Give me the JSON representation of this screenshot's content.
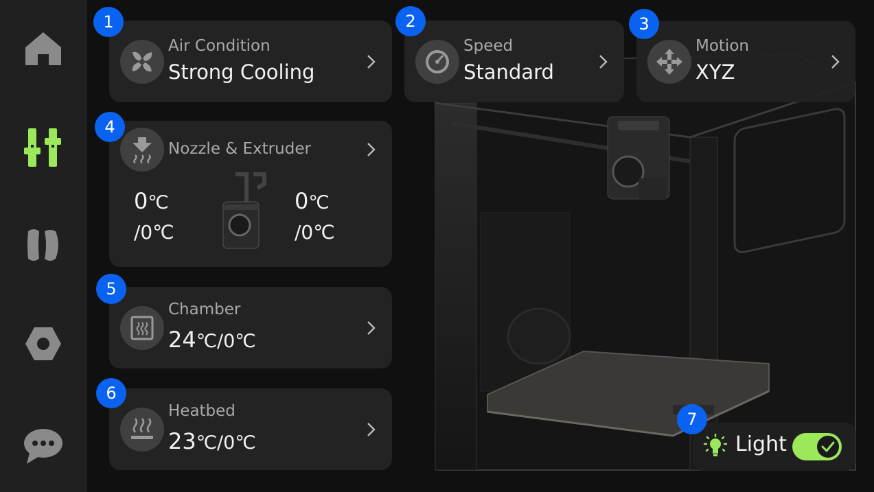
{
  "sidebar": {
    "items": [
      {
        "icon": "home-icon",
        "active": false
      },
      {
        "icon": "sliders-icon",
        "active": true
      },
      {
        "icon": "filament-icon",
        "active": false
      },
      {
        "icon": "settings-hex-icon",
        "active": false
      },
      {
        "icon": "chat-icon",
        "active": false
      }
    ]
  },
  "cards": {
    "air": {
      "badge": "1",
      "label": "Air Condition",
      "value": "Strong Cooling"
    },
    "speed": {
      "badge": "2",
      "label": "Speed",
      "value": "Standard"
    },
    "motion": {
      "badge": "3",
      "label": "Motion",
      "value": "XYZ"
    },
    "nozzle": {
      "badge": "4",
      "label": "Nozzle & Extruder",
      "left_current": "0",
      "left_target": "/0",
      "right_current": "0",
      "right_target": "/0",
      "unit": "℃"
    },
    "chamber": {
      "badge": "5",
      "label": "Chamber",
      "current": "24",
      "target": "/0",
      "unit": "℃"
    },
    "heatbed": {
      "badge": "6",
      "label": "Heatbed",
      "current": "23",
      "target": "/0",
      "unit": "℃"
    }
  },
  "light": {
    "badge": "7",
    "label": "Light",
    "on": true
  },
  "colors": {
    "accent_green": "#9be85a",
    "badge_blue": "#0a63f0"
  }
}
